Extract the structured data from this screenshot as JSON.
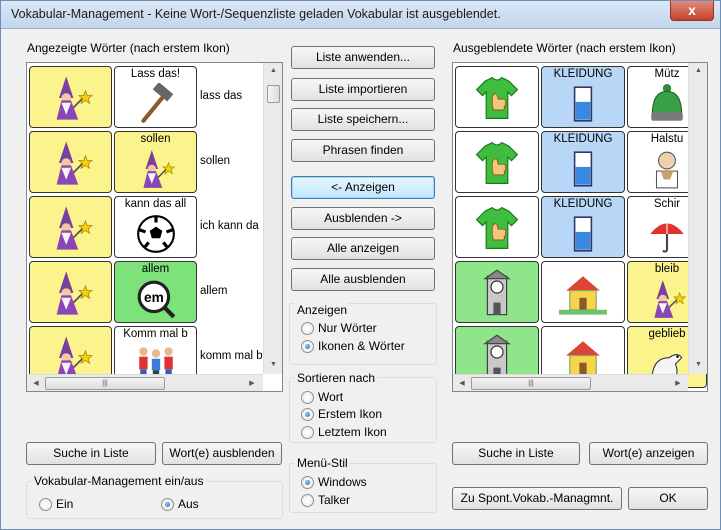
{
  "window": {
    "title": "Vokabular-Management - Keine Wort-/Sequenzliste geladen Vokabular ist ausgeblendet.",
    "close_label": "x"
  },
  "left_panel": {
    "heading": "Angezeigte Wörter (nach erstem Ikon)",
    "rows": [
      {
        "icon1": "wizard-icon",
        "icon2_label": "Lass das!",
        "icon2": "hammer-icon",
        "icon2_color": "#ffffff",
        "text": "lass das"
      },
      {
        "icon1": "wizard-icon",
        "icon2_label": "sollen",
        "icon2": "wizard-icon",
        "icon2_color": "#fbf48c",
        "text": "sollen"
      },
      {
        "icon1": "wizard-icon",
        "icon2_label": "kann das all",
        "icon2": "soccer-ball-icon",
        "icon2_color": "#ffffff",
        "text": "ich kann da"
      },
      {
        "icon1": "wizard-icon",
        "icon2_label": "allem",
        "icon2": "em-magnifier-icon",
        "icon2_color": "#7ee27a",
        "text": "allem"
      },
      {
        "icon1": "wizard-icon",
        "icon2_label": "Komm mal b",
        "icon2": "people-icon",
        "icon2_color": "#ffffff",
        "text": "komm mal b"
      }
    ],
    "search_button": "Suche in Liste",
    "hide_words_button": "Wort(e) ausblenden"
  },
  "center": {
    "buttons": {
      "apply_list": "Liste anwenden...",
      "import_list": "Liste importieren",
      "save_list": "Liste speichern...",
      "find_phrases": "Phrasen finden",
      "show": "<- Anzeigen",
      "hide": "Ausblenden ->",
      "show_all": "Alle anzeigen",
      "hide_all": "Alle ausblenden"
    },
    "display_group": {
      "label": "Anzeigen",
      "options": [
        "Nur Wörter",
        "Ikonen & Wörter"
      ],
      "selected": "Ikonen & Wörter"
    },
    "sort_group": {
      "label": "Sortieren nach",
      "options": [
        "Wort",
        "Erstem Ikon",
        "Letztem Ikon"
      ],
      "selected": "Erstem Ikon"
    },
    "menu_group": {
      "label": "Menü-Stil",
      "options": [
        "Windows",
        "Talker"
      ],
      "selected": "Windows"
    }
  },
  "right_panel": {
    "heading": "Ausgeblendete Wörter (nach erstem Ikon)",
    "rows": [
      [
        {
          "label": "",
          "icon": "green-shirt-thumb-icon",
          "color": "#ffffff"
        },
        {
          "label": "KLEIDUNG",
          "icon": "blue-gauge-icon",
          "color": "#b8d7f7"
        },
        {
          "label": "Mütz",
          "icon": "beanie-icon",
          "color": "#ffffff"
        }
      ],
      [
        {
          "label": "",
          "icon": "green-shirt-thumb-icon",
          "color": "#ffffff"
        },
        {
          "label": "KLEIDUNG",
          "icon": "blue-gauge-icon",
          "color": "#b8d7f7"
        },
        {
          "label": "Halstu",
          "icon": "scarf-person-icon",
          "color": "#ffffff"
        }
      ],
      [
        {
          "label": "",
          "icon": "green-shirt-thumb-icon",
          "color": "#ffffff"
        },
        {
          "label": "KLEIDUNG",
          "icon": "blue-gauge-icon",
          "color": "#b8d7f7"
        },
        {
          "label": "Schir",
          "icon": "umbrella-icon",
          "color": "#ffffff"
        }
      ],
      [
        {
          "label": "",
          "icon": "clock-tower-icon",
          "color": "#8ee58a"
        },
        {
          "label": "",
          "icon": "house-icon",
          "color": "#ffffff"
        },
        {
          "label": "bleib",
          "icon": "wizard-icon",
          "color": "#fbf48c"
        }
      ],
      [
        {
          "label": "",
          "icon": "clock-tower-icon",
          "color": "#8ee58a"
        },
        {
          "label": "",
          "icon": "house-icon",
          "color": "#ffffff"
        },
        {
          "label": "geblieb",
          "icon": "dino-icon",
          "color": "#fbf48c"
        }
      ]
    ],
    "search_button": "Suche in Liste",
    "show_words_button": "Wort(e) anzeigen",
    "spont_button": "Zu Spont.Vokab.-Managmnt.",
    "ok_button": "OK"
  },
  "vocab_toggle": {
    "label": "Vokabular-Management ein/aus",
    "options": [
      "Ein",
      "Aus"
    ],
    "selected": "Aus"
  },
  "colors": {
    "title_gradient_top": "#dbe8f6",
    "close_red": "#c4412a",
    "wizard_yellow": "#fbf48c",
    "focus_blue": "#bee6fd"
  }
}
